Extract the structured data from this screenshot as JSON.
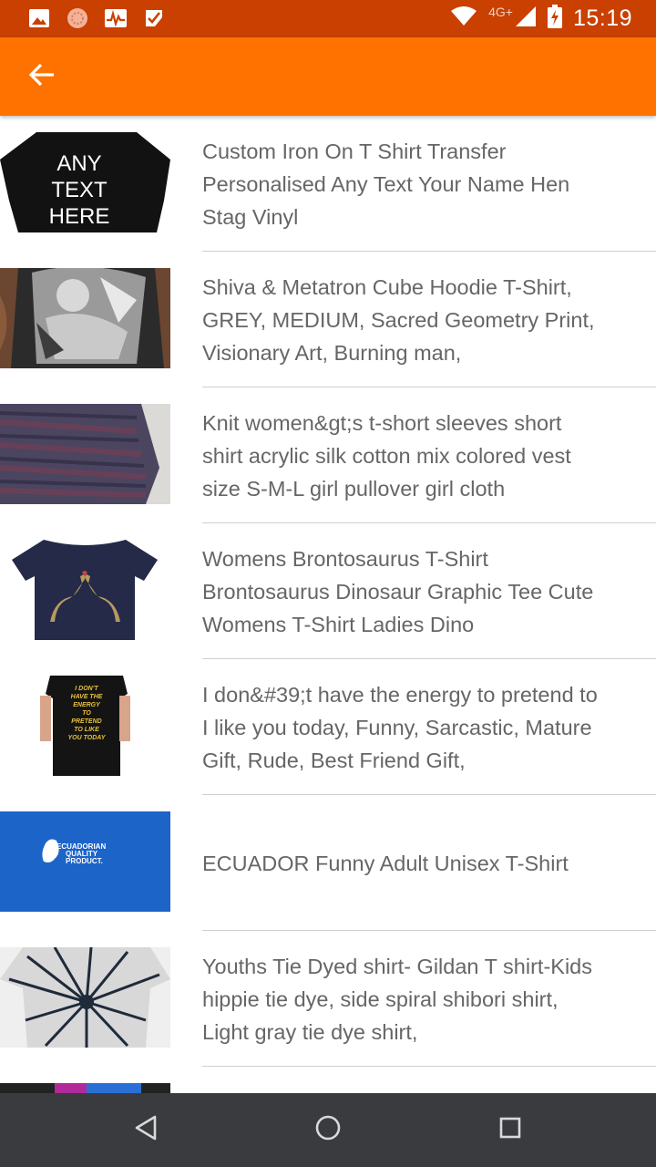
{
  "status_bar": {
    "time": "15:19",
    "network": "4G+",
    "icons": [
      "gallery-icon",
      "app-icon",
      "activity-icon",
      "task-icon",
      "wifi-icon",
      "signal-icon",
      "battery-charging-icon"
    ]
  },
  "app_bar": {
    "back_icon": "arrow-left-icon",
    "color": "#ff7200"
  },
  "products": [
    {
      "title": "Custom Iron On T Shirt Transfer Personalised Any Text Your Name Hen Stag Vinyl",
      "thumb_text": [
        "ANY",
        "TEXT",
        "HERE"
      ]
    },
    {
      "title": "Shiva & Metatron Cube Hoodie T-Shirt, GREY, MEDIUM, Sacred Geometry Print, Visionary Art, Burning man,"
    },
    {
      "title": "Knit women&gt;s t-short sleeves short shirt acrylic silk cotton mix colored vest size S-M-L girl pullover girl cloth"
    },
    {
      "title": "Womens Brontosaurus T-Shirt Brontosaurus Dinosaur Graphic Tee Cute Womens T-Shirt Ladies Dino"
    },
    {
      "title": "I don&#39;t have the energy to pretend to I like you today, Funny, Sarcastic, Mature Gift, Rude, Best Friend Gift,",
      "thumb_text": [
        "I DON'T",
        "HAVE THE",
        "ENERGY",
        "TO",
        "PRETEND",
        "TO LIKE",
        "YOU TODAY"
      ]
    },
    {
      "title": "ECUADOR Funny Adult Unisex T-Shirt",
      "thumb_text": [
        "ECUADORIAN",
        "QUALITY",
        "PRODUCT."
      ]
    },
    {
      "title": "Youths Tie Dyed shirt- Gildan T shirt-Kids hippie tie dye, side spiral shibori shirt, Light gray tie dye shirt,"
    }
  ],
  "nav_bar": {
    "back_icon": "nav-back-icon",
    "home_icon": "nav-home-icon",
    "recents_icon": "nav-recents-icon"
  }
}
